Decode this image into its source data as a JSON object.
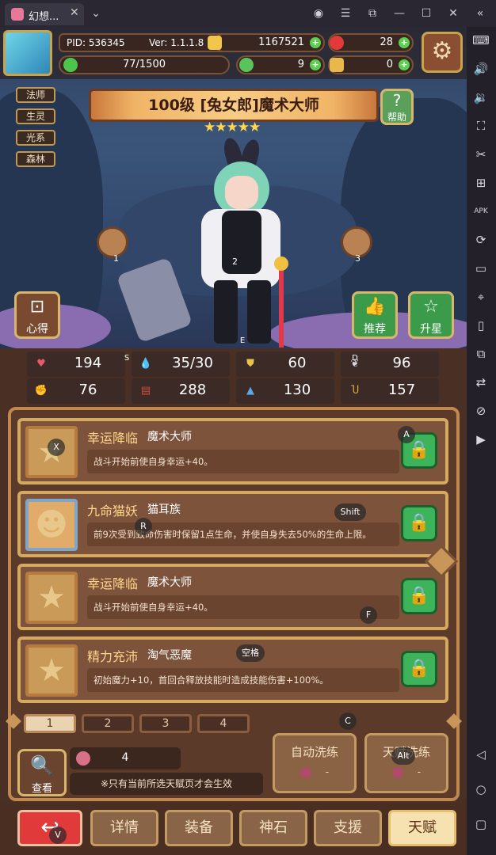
{
  "window": {
    "tab_title": "幻想...",
    "controls": {
      "account": "account-icon",
      "menu": "menu-icon",
      "external": "external-icon",
      "minimize": "minimize-icon",
      "maximize": "maximize-icon",
      "close": "close-icon",
      "collapse": "collapse-icon"
    }
  },
  "player": {
    "pid": "PID: 536345",
    "ver": "Ver: 1.1.1.8",
    "exp": "77/1500"
  },
  "currency": {
    "gold": "1167521",
    "gems": "28",
    "clover": "9",
    "keys": "0"
  },
  "tags": [
    "法师",
    "生灵",
    "光系",
    "森林"
  ],
  "character": {
    "title": "100级 [兔女郎]魔术大师",
    "stars": "★★★★★",
    "help": "帮助",
    "slot1": "1",
    "slot2": "2",
    "slot3": "3",
    "xinde": "心得",
    "recommend": "推荐",
    "upgrade": "升星"
  },
  "stats": [
    {
      "icon": "heart",
      "value": "194",
      "color": "#e65a6a"
    },
    {
      "icon": "drop",
      "value": "35/30",
      "color": "#4fb4e8"
    },
    {
      "icon": "shield",
      "value": "60",
      "color": "#e8c34a"
    },
    {
      "icon": "wing",
      "value": "96",
      "color": "#cfd6e0"
    },
    {
      "icon": "fist",
      "value": "76",
      "color": "#e7a08a"
    },
    {
      "icon": "book",
      "value": "288",
      "color": "#d24a3a"
    },
    {
      "icon": "boot",
      "value": "130",
      "color": "#5aa8e8"
    },
    {
      "icon": "horseshoe",
      "value": "157",
      "color": "#e8b64a"
    }
  ],
  "talents": [
    {
      "name": "幸运降临",
      "type": "魔术大师",
      "desc": "战斗开始前使自身幸运+40。"
    },
    {
      "name": "九命猫妖",
      "type": "猫耳族",
      "desc": "前9次受到致命伤害时保留1点生命，并使自身失去50%的生命上限。"
    },
    {
      "name": "幸运降临",
      "type": "魔术大师",
      "desc": "战斗开始前使自身幸运+40。"
    },
    {
      "name": "精力充沛",
      "type": "淘气恶魔",
      "desc": "初始魔力+10，首回合释放技能时造成技能伤害+100%。"
    }
  ],
  "pages": [
    "1",
    "2",
    "3",
    "4"
  ],
  "reroll": {
    "count": "4",
    "note": "※只有当前所选天赋页才会生效",
    "view": "查看",
    "auto": "自动洗练",
    "talent": "天赋洗练",
    "auto_cost": "-",
    "talent_cost": "-"
  },
  "nav": [
    "详情",
    "装备",
    "神石",
    "支援",
    "天赋"
  ],
  "keyhints": {
    "S": "S",
    "D": "D",
    "E": "E",
    "A": "A",
    "X": "X",
    "R": "R",
    "Shift": "Shift",
    "F": "F",
    "Space": "空格",
    "C": "C",
    "Alt": "Alt",
    "V": "V"
  }
}
